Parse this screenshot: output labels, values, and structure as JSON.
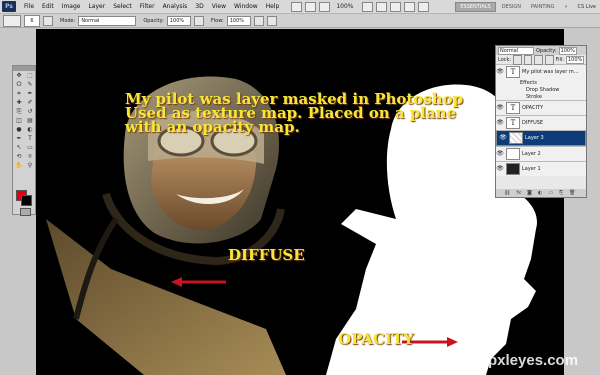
{
  "menubar": {
    "logo": "Ps",
    "items": [
      "File",
      "Edit",
      "Image",
      "Layer",
      "Select",
      "Filter",
      "Analysis",
      "3D",
      "View",
      "Window",
      "Help"
    ],
    "zoom": "100%",
    "workspaces": [
      "ESSENTIALS",
      "DESIGN",
      "PAINTING"
    ],
    "cs_live": "CS Live"
  },
  "options": {
    "brush_size": "6",
    "mode_label": "Mode:",
    "mode_value": "Normal",
    "opacity_label": "Opacity:",
    "opacity_value": "100%",
    "flow_label": "Flow:",
    "flow_value": "100%"
  },
  "tools": {
    "icons": [
      "move-tool",
      "marquee-tool",
      "lasso-tool",
      "quick-select-tool",
      "crop-tool",
      "eyedropper-tool",
      "healing-tool",
      "brush-tool",
      "clone-tool",
      "history-brush-tool",
      "eraser-tool",
      "gradient-tool",
      "blur-tool",
      "dodge-tool",
      "pen-tool",
      "type-tool",
      "path-select-tool",
      "shape-tool",
      "3d-rotate-tool",
      "3d-camera-tool",
      "hand-tool",
      "zoom-tool"
    ],
    "glyphs": [
      "✥",
      "⬚",
      "ⵔ",
      "✎",
      "⌗",
      "✒",
      "✚",
      "✐",
      "⎘",
      "↺",
      "◫",
      "▤",
      "●",
      "◐",
      "✒",
      "T",
      "↖",
      "▭",
      "⟲",
      "⌾",
      "✋",
      "⚲"
    ],
    "foreground_color": "#e00010",
    "background_color": "#000000"
  },
  "layers_panel": {
    "blend_mode": "Normal",
    "opacity_label": "Opacity:",
    "opacity_value": "100%",
    "lock_label": "Lock:",
    "fill_label": "Fill:",
    "fill_value": "100%",
    "layers": [
      {
        "name": "My pilot was layer m...",
        "thumb": "T",
        "selected": false
      },
      {
        "name": "OPACITY",
        "thumb": "T",
        "selected": false
      },
      {
        "name": "DIFFUSE",
        "thumb": "T",
        "selected": false
      },
      {
        "name": "Layer 3",
        "thumb": "",
        "selected": true
      },
      {
        "name": "Layer 2",
        "thumb": "",
        "selected": false
      },
      {
        "name": "Layer 1",
        "thumb": "",
        "selected": false
      }
    ],
    "effects": {
      "label": "Effects",
      "items": [
        "Drop Shadow",
        "Stroke"
      ]
    }
  },
  "canvas": {
    "caption_lines": [
      "My pilot was layer masked in Photoshop",
      "Used as texture map. Placed on a plane",
      "with an opacity map."
    ],
    "diffuse_label": "DIFFUSE",
    "opacity_label": "OPACITY",
    "arrow_color": "#c8141e",
    "text_color": "#f5e63a"
  },
  "watermark": "pxleyes.com"
}
